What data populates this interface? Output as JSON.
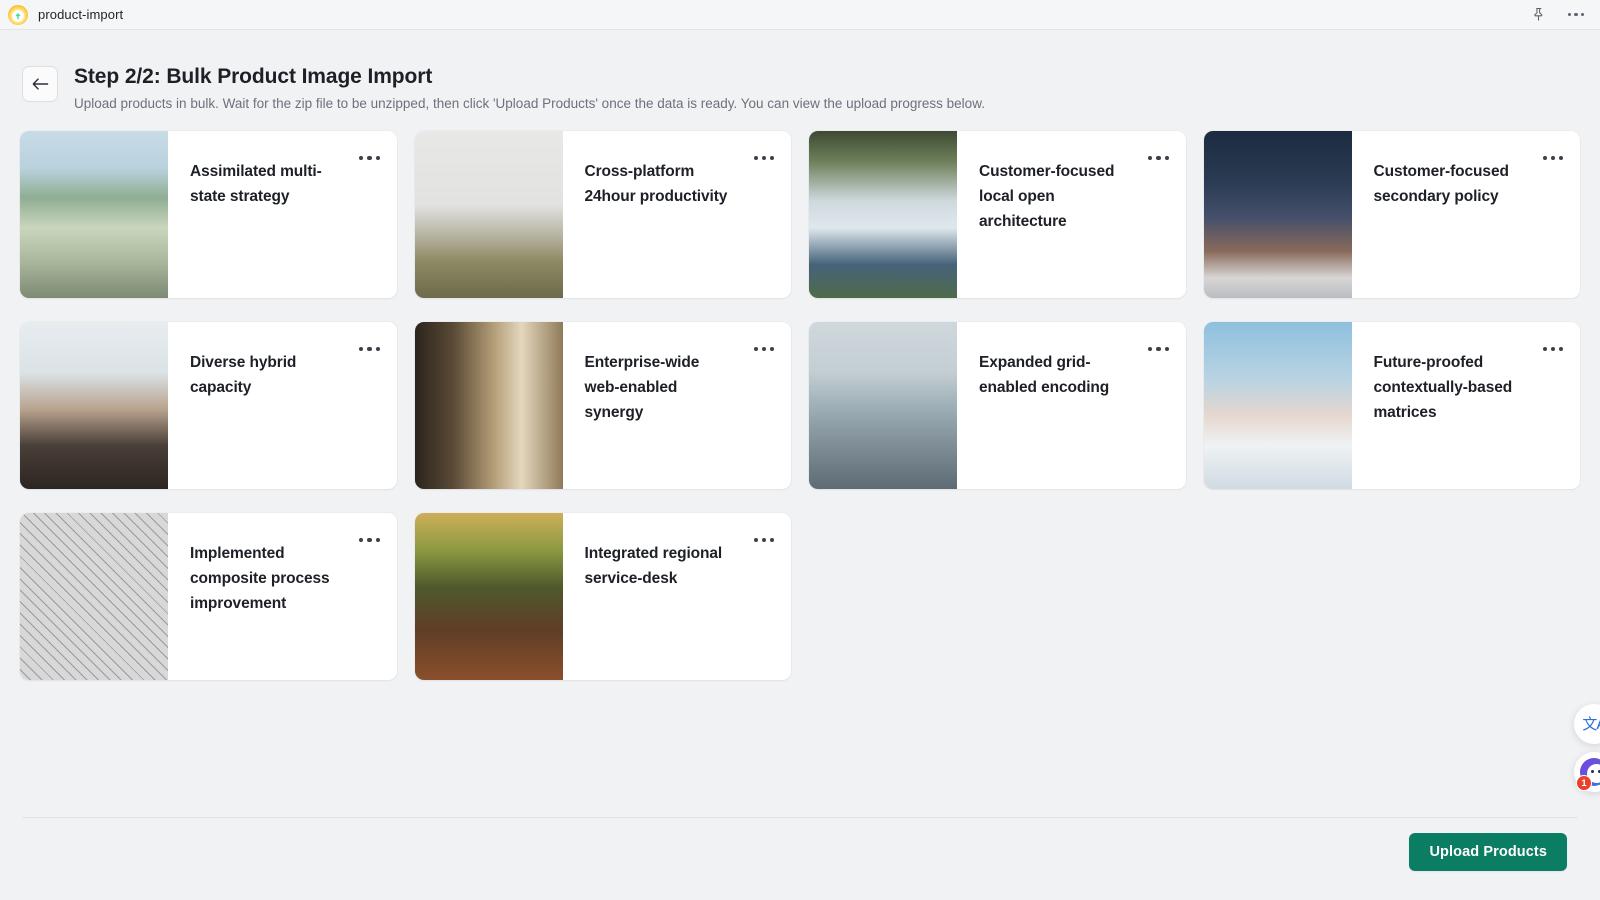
{
  "titlebar": {
    "app_name": "product-import",
    "app_icon": "cloud-upload-icon",
    "pin_icon": "pin-icon",
    "more_icon": "more-horizontal-icon"
  },
  "header": {
    "back_icon": "arrow-left-icon",
    "title": "Step 2/2: Bulk Product Image Import",
    "subtitle": "Upload products in bulk. Wait for the zip file to be unzipped, then click 'Upload Products' once the data is ready. You can view the upload progress below."
  },
  "products": [
    {
      "name": "Assimilated multi-state strategy",
      "menu_icon": "more-horizontal-icon",
      "thumb": "dock-lake-fog"
    },
    {
      "name": "Cross-platform 24hour productivity",
      "menu_icon": "more-horizontal-icon",
      "thumb": "misty-mountain-trail"
    },
    {
      "name": "Customer-focused local open architecture",
      "menu_icon": "more-horizontal-icon",
      "thumb": "waterfall-cliff"
    },
    {
      "name": "Customer-focused secondary policy",
      "menu_icon": "more-horizontal-icon",
      "thumb": "starry-night-desert"
    },
    {
      "name": "Diverse hybrid capacity",
      "menu_icon": "more-horizontal-icon",
      "thumb": "cafe-interior"
    },
    {
      "name": "Enterprise-wide web-enabled synergy",
      "menu_icon": "more-horizontal-icon",
      "thumb": "city-buildings-alley"
    },
    {
      "name": "Expanded grid-enabled encoding",
      "menu_icon": "more-horizontal-icon",
      "thumb": "snowy-rooftops-city"
    },
    {
      "name": "Future-proofed contextually-based matrices",
      "menu_icon": "more-horizontal-icon",
      "thumb": "clouds-above-sky"
    },
    {
      "name": "Implemented composite process improvement",
      "menu_icon": "more-horizontal-icon",
      "thumb": "glass-lattice-roof"
    },
    {
      "name": "Integrated regional service-desk",
      "menu_icon": "more-horizontal-icon",
      "thumb": "mossy-log-autumn"
    }
  ],
  "footer": {
    "upload_label": "Upload Products"
  },
  "widgets": {
    "translate_glyph": "文A",
    "translate_icon": "translate-icon",
    "chat_icon": "chat-support-icon",
    "chat_badge": "1"
  },
  "colors": {
    "accent_green": "#0b7d63",
    "badge_red": "#e8412c",
    "page_bg": "#f1f2f4",
    "card_bg": "#ffffff"
  }
}
